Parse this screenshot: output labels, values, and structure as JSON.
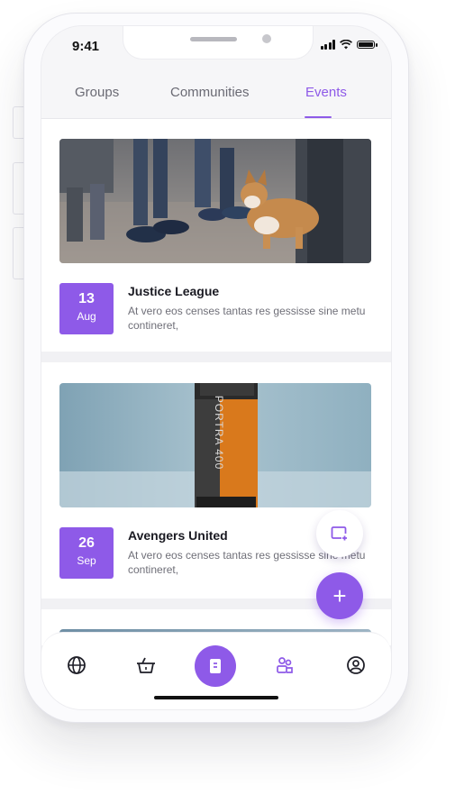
{
  "status_bar": {
    "time": "9:41"
  },
  "tabs": [
    {
      "label": "Groups",
      "active": false
    },
    {
      "label": "Communities",
      "active": false
    },
    {
      "label": "Events",
      "active": true
    }
  ],
  "events": [
    {
      "title": "Justice League",
      "description": "At vero eos censes tantas res gessisse sine metu contineret,",
      "day": "13",
      "month": "Aug",
      "image": "people-walking-with-corgi-photo"
    },
    {
      "title": "Avengers United",
      "description": "At vero eos censes tantas res gessisse sine metu contineret,",
      "day": "26",
      "month": "Sep",
      "image": "film-canister-photo",
      "image_text": "PORTRA 400"
    }
  ],
  "fabs": {
    "secondary_icon": "add-to-calendar-icon",
    "primary_label": "+"
  },
  "bottom_nav": [
    {
      "icon": "globe-icon"
    },
    {
      "icon": "basket-icon"
    },
    {
      "icon": "ticket-icon",
      "active": true
    },
    {
      "icon": "group-icon"
    },
    {
      "icon": "profile-icon"
    }
  ],
  "colors": {
    "accent": "#8e5ae8",
    "background": "#f1f1f4",
    "text": "#1a1a22",
    "muted": "#6f6f78"
  }
}
